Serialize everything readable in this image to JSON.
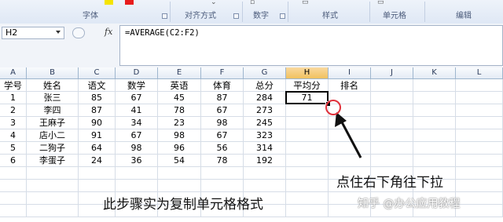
{
  "ribbon": {
    "groups": [
      {
        "name": "font-group",
        "label": "字体"
      },
      {
        "name": "alignment-group",
        "label": "对齐方式"
      },
      {
        "name": "number-group",
        "label": "数字"
      },
      {
        "name": "styles-group",
        "label": "样式"
      },
      {
        "name": "cells-group",
        "label": "单元格"
      },
      {
        "name": "editing-group",
        "label": "编辑"
      }
    ],
    "font_fill_color": "#f5e400",
    "font_text_color": "#e81c1c"
  },
  "formula_bar": {
    "name_box": "H2",
    "fx": "fx",
    "formula": "=AVERAGE(C2:F2)"
  },
  "sheet": {
    "columns": [
      "A",
      "B",
      "C",
      "D",
      "E",
      "F",
      "G",
      "H",
      "I",
      "J",
      "K",
      "L"
    ],
    "selected_column": "H",
    "rows": [
      [
        "学号",
        "姓名",
        "语文",
        "数学",
        "英语",
        "体育",
        "总分",
        "平均分",
        "排名"
      ],
      [
        "1",
        "张三",
        "85",
        "67",
        "45",
        "87",
        "284",
        "71",
        ""
      ],
      [
        "2",
        "李四",
        "87",
        "41",
        "78",
        "67",
        "273",
        "",
        ""
      ],
      [
        "3",
        "王麻子",
        "90",
        "34",
        "23",
        "98",
        "245",
        "",
        ""
      ],
      [
        "4",
        "店小二",
        "91",
        "67",
        "98",
        "67",
        "323",
        "",
        ""
      ],
      [
        "5",
        "二狗子",
        "64",
        "98",
        "96",
        "56",
        "314",
        "",
        ""
      ],
      [
        "6",
        "李蛋子",
        "24",
        "36",
        "54",
        "78",
        "192",
        "",
        ""
      ]
    ]
  },
  "annotations": {
    "drag_hint": "点住右下角往下拉",
    "step_caption": "此步骤实为复制单元格格式",
    "watermark": "知乎 @办公应用教程",
    "circle_color": "#e0303a"
  }
}
